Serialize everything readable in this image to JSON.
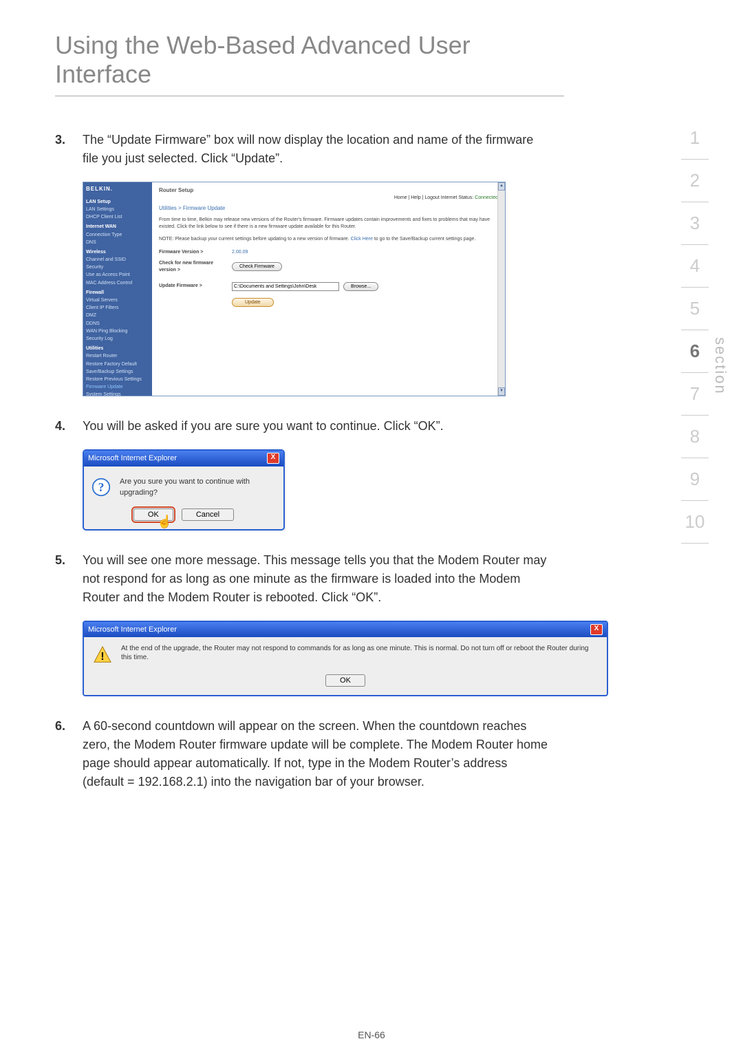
{
  "page": {
    "title": "Using the Web-Based Advanced User Interface",
    "footer": "EN-66",
    "section_label": "section"
  },
  "section_nav": {
    "items": [
      "1",
      "2",
      "3",
      "4",
      "5",
      "6",
      "7",
      "8",
      "9",
      "10"
    ],
    "active_index": 5
  },
  "steps": {
    "s3": {
      "num": "3.",
      "text": "The “Update Firmware” box will now display the location and name of the firmware file you just selected. Click “Update”."
    },
    "s4": {
      "num": "4.",
      "text": "You will be asked if you are sure you want to continue. Click “OK”."
    },
    "s5": {
      "num": "5.",
      "text": "You will see one more message. This message tells you that the Modem Router may not respond for as long as one minute as the firmware is loaded into the Modem Router and the Modem Router is rebooted. Click “OK”."
    },
    "s6": {
      "num": "6.",
      "text": "A 60-second countdown will appear on the screen. When the countdown reaches zero, the Modem Router firmware update will be complete. The Modem Router home page should appear automatically. If not, type in the Modem Router’s address (default = 192.168.2.1) into the navigation bar of your browser."
    }
  },
  "router": {
    "brand": "BELKIN.",
    "top": "Router Setup",
    "status_prefix": "Home | Help | Logout   Internet Status:",
    "status_value": "Connected",
    "breadcrumb": "Utilities > Firmware Update",
    "desc": "From time to time, Belkin may release new versions of the Router's firmware. Firmware updates contain improvements and fixes to problems that may have existed. Click the link below to see if there is a new firmware update available for this Router.",
    "note_prefix": "NOTE: Please backup your current settings before updating to a new version of firmware.",
    "note_link": "Click Here",
    "note_suffix": "to go to the Save/Backup current settings page.",
    "fw_version_label": "Firmware Version >",
    "fw_version_value": "2.00.09",
    "check_label": "Check for new firmware version >",
    "check_button": "Check Firmware",
    "update_label": "Update Firmware >",
    "browse_value": "C:\\Documents and Settings\\John\\Desk",
    "browse_button": "Browse...",
    "update_button": "Update",
    "sidebar": {
      "groups": [
        {
          "cat": "LAN Setup",
          "items": [
            "LAN Settings",
            "DHCP Client List"
          ]
        },
        {
          "cat": "Internet WAN",
          "items": [
            "Connection Type",
            "DNS"
          ]
        },
        {
          "cat": "Wireless",
          "items": [
            "Channel and SSID",
            "Security",
            "Use as Access Point",
            "MAC Address Control"
          ]
        },
        {
          "cat": "Firewall",
          "items": [
            "Virtual Servers",
            "Client IP Filters",
            "DMZ",
            "DDNS",
            "WAN Ping Blocking",
            "Security Log"
          ]
        },
        {
          "cat": "Utilities",
          "items": [
            "Restart Router",
            "Restore Factory Default",
            "Save/Backup Settings",
            "Restore Previous Settings",
            "Firmware Update",
            "System Settings"
          ]
        }
      ],
      "active": "Firmware Update"
    }
  },
  "dialog_confirm": {
    "title": "Microsoft Internet Explorer",
    "msg": "Are you sure you want to continue with upgrading?",
    "ok": "OK",
    "cancel": "Cancel",
    "close": "X"
  },
  "dialog_warning": {
    "title": "Microsoft Internet Explorer",
    "msg": "At the end of the upgrade, the Router may not respond to commands for as long as one minute. This is normal. Do not turn off or reboot the Router during this time.",
    "ok": "OK",
    "close": "X"
  }
}
